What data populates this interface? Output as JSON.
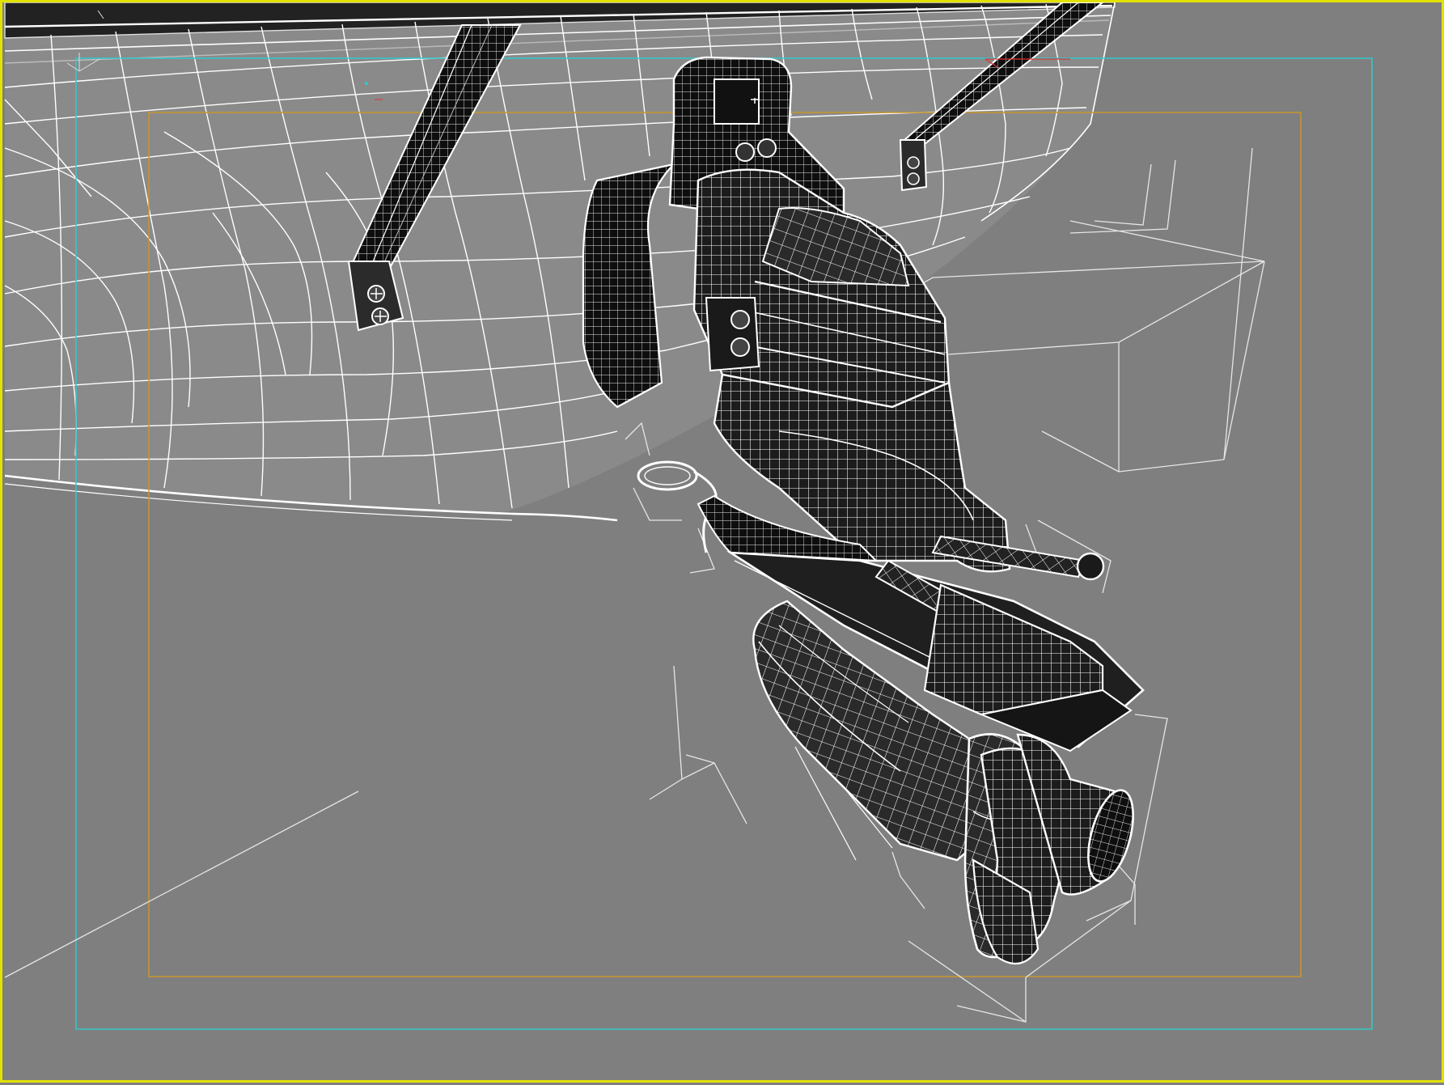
{
  "viewport": {
    "active_border_color": "#e2e200",
    "background_color": "#7f7f7f",
    "safe_frame_outer_color": "#33c9cc",
    "safe_frame_inner_color": "#c8962e"
  },
  "scene": {
    "objects": [
      {
        "name": "boat-hull",
        "render_mode": "wireframe"
      },
      {
        "name": "outboard-motor",
        "render_mode": "wireframe"
      },
      {
        "name": "mount-bracket-left",
        "render_mode": "wireframe"
      },
      {
        "name": "mount-bracket-right",
        "render_mode": "wireframe"
      }
    ],
    "wire_color": "#ffffff"
  },
  "icons": {
    "axis_tripod": "axis-tripod-icon"
  }
}
